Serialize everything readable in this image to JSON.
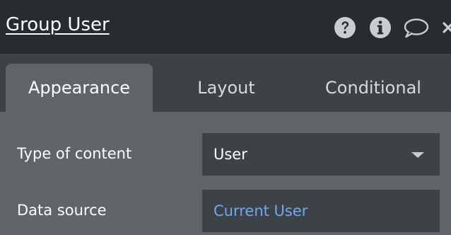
{
  "header": {
    "title": "Group User",
    "icons": [
      "help-icon",
      "info-icon",
      "comment-icon",
      "close-icon"
    ]
  },
  "tabs": [
    {
      "label": "Appearance",
      "active": true
    },
    {
      "label": "Layout",
      "active": false
    },
    {
      "label": "Conditional",
      "active": false
    }
  ],
  "fields": {
    "type_of_content": {
      "label": "Type of content",
      "value": "User"
    },
    "data_source": {
      "label": "Data source",
      "value": "Current User"
    }
  },
  "colors": {
    "header_bg": "#272c2f",
    "tabbar_bg": "#3c4245",
    "panel_bg": "#5f6568",
    "link": "#6ea8f7"
  }
}
